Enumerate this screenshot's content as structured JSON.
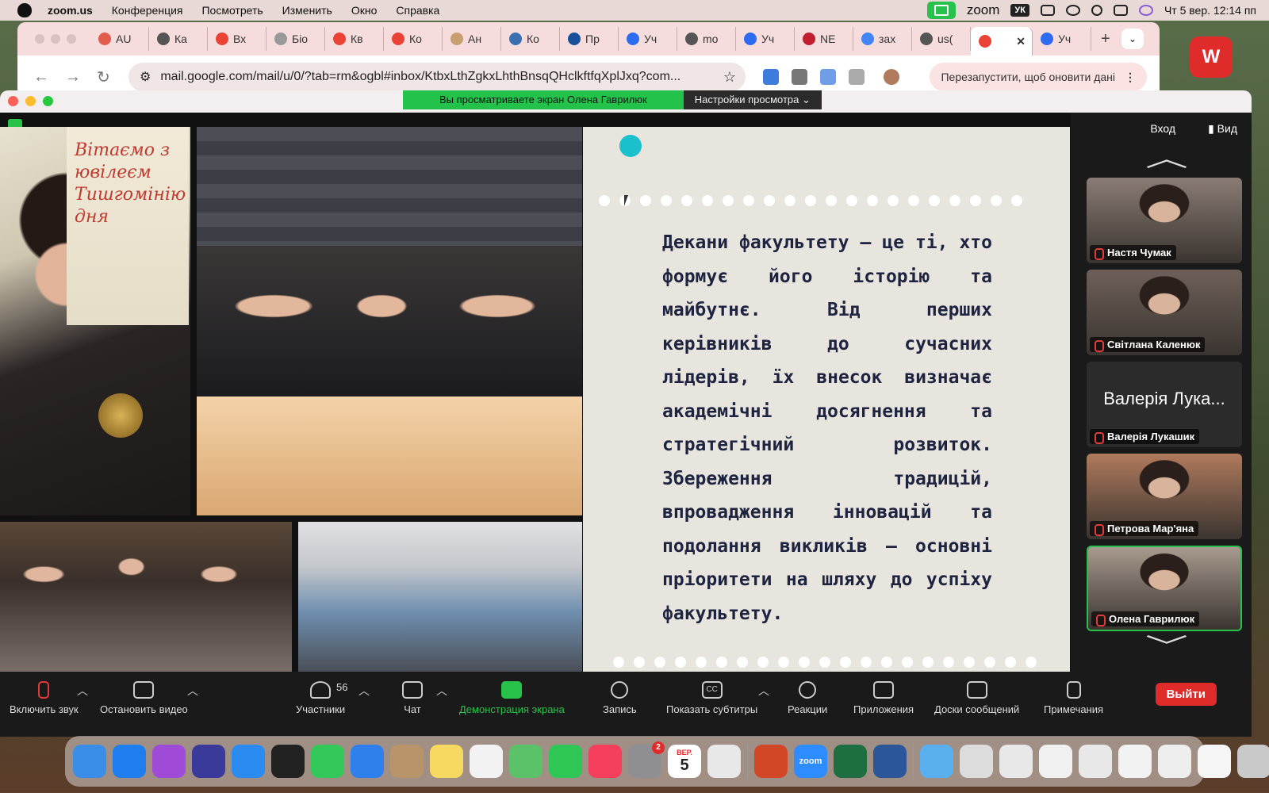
{
  "menubar": {
    "app": "zoom.us",
    "items": [
      "Конференция",
      "Посмотреть",
      "Изменить",
      "Окно",
      "Справка"
    ],
    "zoom_label": "zoom",
    "keyboard": "УК",
    "clock": "Чт 5 вер.  12:14 пп"
  },
  "browser": {
    "tabs": [
      {
        "label": "AU",
        "color": "#e25c4c"
      },
      {
        "label": "Ка",
        "color": "#555555"
      },
      {
        "label": "Вх",
        "color": "#ea4335"
      },
      {
        "label": "Біо",
        "color": "#999999"
      },
      {
        "label": "Кв",
        "color": "#ea4335"
      },
      {
        "label": "Ко",
        "color": "#ea4335"
      },
      {
        "label": "Ан",
        "color": "#c8a070"
      },
      {
        "label": "Ко",
        "color": "#3a6fb0"
      },
      {
        "label": "Пр",
        "color": "#1a4f9a"
      },
      {
        "label": "Уч",
        "color": "#2d6cf0"
      },
      {
        "label": "mo",
        "color": "#555555"
      },
      {
        "label": "Уч",
        "color": "#2d6cf0"
      },
      {
        "label": "NE",
        "color": "#c01f2f"
      },
      {
        "label": "зах",
        "color": "#4285f4"
      },
      {
        "label": "us(",
        "color": "#555555"
      },
      {
        "label": "",
        "color": "#ea4335",
        "active": true
      },
      {
        "label": "Уч",
        "color": "#2d6cf0"
      }
    ],
    "url": "mail.google.com/mail/u/0/?tab=rm&ogbl#inbox/KtbxLthZgkxLhthBnsqQHclkftfqXplJxq?com...",
    "relaunch": "Перезапустити, щоб оновити дані"
  },
  "zoom": {
    "sharing_banner": "Вы просматриваете экран Олена Гаврилюк",
    "view_settings": "Настройки просмотра",
    "login": "Вход",
    "view": "Вид",
    "slide_text": "Декани факультету – це ті, хто формує його історію та майбутнє. Від перших керівників до сучасних лідерів, їх внесок визначає академічні досягнення та стратегічний розвиток. Збереження традицій, впровадження інновацій та подолання викликів – основні пріоритети на шляху до успіху факультету.",
    "poster_text": "Вітаємо з ювілеєм Тишгомінію дня",
    "participants": [
      {
        "name": "Настя Чумак",
        "video": "#8a7c74"
      },
      {
        "name": "Світлана Каленюк",
        "video": "#6e6058"
      },
      {
        "name": "Валерія Лукашик",
        "big": "Валерія Лука..."
      },
      {
        "name": "Петрова Мар'яна",
        "video": "#b07a5c"
      },
      {
        "name": "Олена Гаврилюк",
        "video": "#a89a8e",
        "active": true
      }
    ],
    "toolbar": {
      "mute": "Включить звук",
      "video": "Остановить видео",
      "participants": "Участники",
      "participants_count": "56",
      "chat": "Чат",
      "share": "Демонстрация экрана",
      "record": "Запись",
      "captions": "Показать субтитры",
      "reactions": "Реакции",
      "apps": "Приложения",
      "whiteboards": "Доски сообщений",
      "notes": "Примечания",
      "leave": "Выйти"
    },
    "cc": "CC"
  },
  "dock": {
    "calendar_month": "ВЕР.",
    "calendar_day": "5",
    "settings_badge": "2",
    "zoom_label": "zoom",
    "apps": [
      {
        "name": "finder",
        "color": "#3b8ee8"
      },
      {
        "name": "app-store",
        "color": "#1e7ef0"
      },
      {
        "name": "podcasts",
        "color": "#a04bd8"
      },
      {
        "name": "siri",
        "color": "#3a3a9a"
      },
      {
        "name": "safari",
        "color": "#2a8cf0"
      },
      {
        "name": "piano",
        "color": "#222222"
      },
      {
        "name": "messages",
        "color": "#34c759"
      },
      {
        "name": "mail",
        "color": "#2f80ed"
      },
      {
        "name": "contacts",
        "color": "#b9946a"
      },
      {
        "name": "notes",
        "color": "#f7d860"
      },
      {
        "name": "reminders",
        "color": "#f2f2f2"
      },
      {
        "name": "maps",
        "color": "#5cc26a"
      },
      {
        "name": "facetime",
        "color": "#2ec655"
      },
      {
        "name": "music",
        "color": "#f43e5c"
      },
      {
        "name": "system-settings",
        "color": "#8e8e93"
      },
      {
        "name": "calendar",
        "color": "#ffffff"
      },
      {
        "name": "chrome",
        "color": "#e8e8e8"
      },
      {
        "name": "powerpoint",
        "color": "#d24726"
      },
      {
        "name": "zoom",
        "color": "#2d8cff"
      },
      {
        "name": "excel",
        "color": "#1d6f42"
      },
      {
        "name": "word",
        "color": "#2b579a"
      },
      {
        "name": "downloads-folder",
        "color": "#5ab0ee"
      },
      {
        "name": "recent-1",
        "color": "#dcdcdc"
      },
      {
        "name": "recent-2",
        "color": "#e8e8e8"
      },
      {
        "name": "recent-3",
        "color": "#f0f0f0"
      },
      {
        "name": "recent-4",
        "color": "#e8e8e8"
      },
      {
        "name": "recent-5",
        "color": "#f2f2f2"
      },
      {
        "name": "recent-6",
        "color": "#eeeeee"
      },
      {
        "name": "recent-7",
        "color": "#f5f5f5"
      },
      {
        "name": "trash",
        "color": "#c9c9c9"
      }
    ]
  }
}
